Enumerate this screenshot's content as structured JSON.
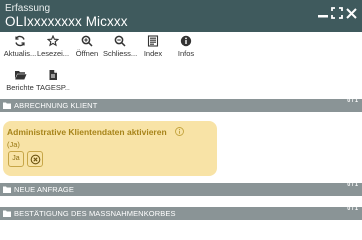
{
  "window": {
    "title": "Erfassung",
    "subtitle": "OLIxxxxxxxx Micxxx"
  },
  "toolbar": {
    "row1": [
      {
        "id": "aktualisieren",
        "label": "Aktualis...",
        "icon": "refresh-icon"
      },
      {
        "id": "lesezeichen",
        "label": "Lesezei...",
        "icon": "star-icon"
      },
      {
        "id": "oeffnen",
        "label": "Öffnen",
        "icon": "zoom-in-icon"
      },
      {
        "id": "schliessen",
        "label": "Schliess...",
        "icon": "zoom-out-icon"
      },
      {
        "id": "index",
        "label": "Index",
        "icon": "document-icon"
      },
      {
        "id": "infos",
        "label": "Infos",
        "icon": "info-icon"
      }
    ],
    "row2": [
      {
        "id": "berichte",
        "label": "Berichte",
        "icon": "folder-open-icon"
      },
      {
        "id": "tagesp",
        "label": "TAGESP...",
        "icon": "file-icon"
      }
    ]
  },
  "sections": [
    {
      "label": "ABRECHNUNG KLIENT",
      "count": "0 / 1"
    },
    {
      "label": "NEUE ANFRAGE",
      "count": "0 / 1"
    },
    {
      "label": "BESTÄTIGUNG DES MASSNAHMENKORBES",
      "count": "0 / 1"
    }
  ],
  "card": {
    "title": "Administrative Klientendaten aktivieren",
    "value": "(Ja)",
    "yes_button": "Ja"
  },
  "colors": {
    "titlebar": "#3f5a5d",
    "section_header": "#8a9496",
    "card_background": "#f8e3a6",
    "card_text": "#a7841a"
  }
}
